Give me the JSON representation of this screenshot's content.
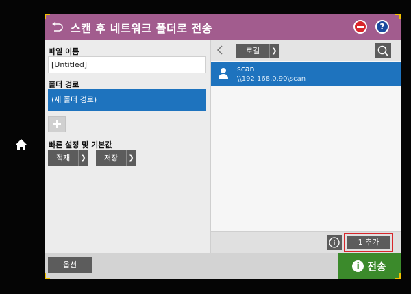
{
  "header": {
    "title": "스캔 후 네트워크 폴더로 전송",
    "help_glyph": "?",
    "color": "#a25c8e"
  },
  "left": {
    "file_name_label": "파일 이름",
    "file_name_value": "[Untitled]",
    "folder_path_label": "폴더 경로",
    "folder_path_value": "(새 폴더 경로)",
    "quick_sets_label": "빠른 설정 및 기본값",
    "load_label": "적재",
    "save_label": "저장"
  },
  "right": {
    "location_label": "로컬",
    "items": [
      {
        "name": "scan",
        "path": "\\\\192.168.0.90\\scan"
      }
    ],
    "add_label": "1 추가"
  },
  "footer": {
    "options_label": "옵션",
    "send_label": "전송",
    "send_icon_glyph": "i",
    "send_color": "#3b8a2b"
  },
  "icons": [
    "home-icon",
    "back-icon",
    "cancel-icon",
    "help-icon",
    "chevron-left-icon",
    "chevron-right-icon",
    "search-icon",
    "person-icon",
    "info-icon",
    "plus-icon"
  ]
}
